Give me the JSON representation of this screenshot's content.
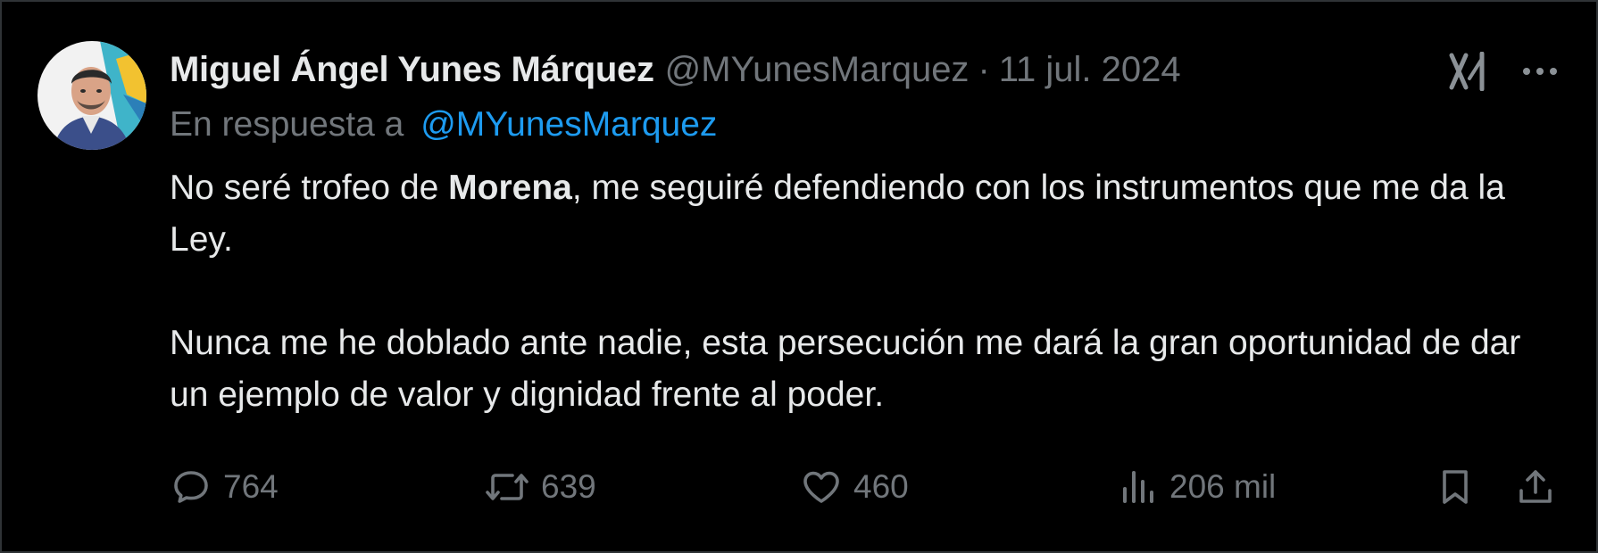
{
  "author": {
    "display_name": "Miguel Ángel Yunes Márquez",
    "handle": "@MYunesMarquez",
    "separator": "·",
    "date": "11 jul. 2024",
    "avatar_icon": "profile-photo"
  },
  "reply": {
    "prefix": "En respuesta a",
    "handle": "@MYunesMarquez"
  },
  "body": {
    "p1_before": "No seré trofeo de ",
    "p1_bold": "Morena",
    "p1_after": ", me seguiré defendiendo con los instrumentos que me da la Ley.",
    "p2": "Nunca me he doblado ante nadie, esta persecución me dará la gran oportunidad de dar un ejemplo de valor y dignidad frente al poder."
  },
  "metrics": {
    "replies": "764",
    "reposts": "639",
    "likes": "460",
    "views": "206 mil"
  },
  "icons": {
    "grok": "grok-icon",
    "more": "more-icon",
    "reply": "reply-icon",
    "repost": "repost-icon",
    "like": "heart-icon",
    "views": "views-icon",
    "bookmark": "bookmark-icon",
    "share": "share-icon"
  },
  "colors": {
    "background": "#000000",
    "primary_text": "#e7e9ea",
    "secondary_text": "#71767b",
    "link": "#1d9bf0"
  }
}
